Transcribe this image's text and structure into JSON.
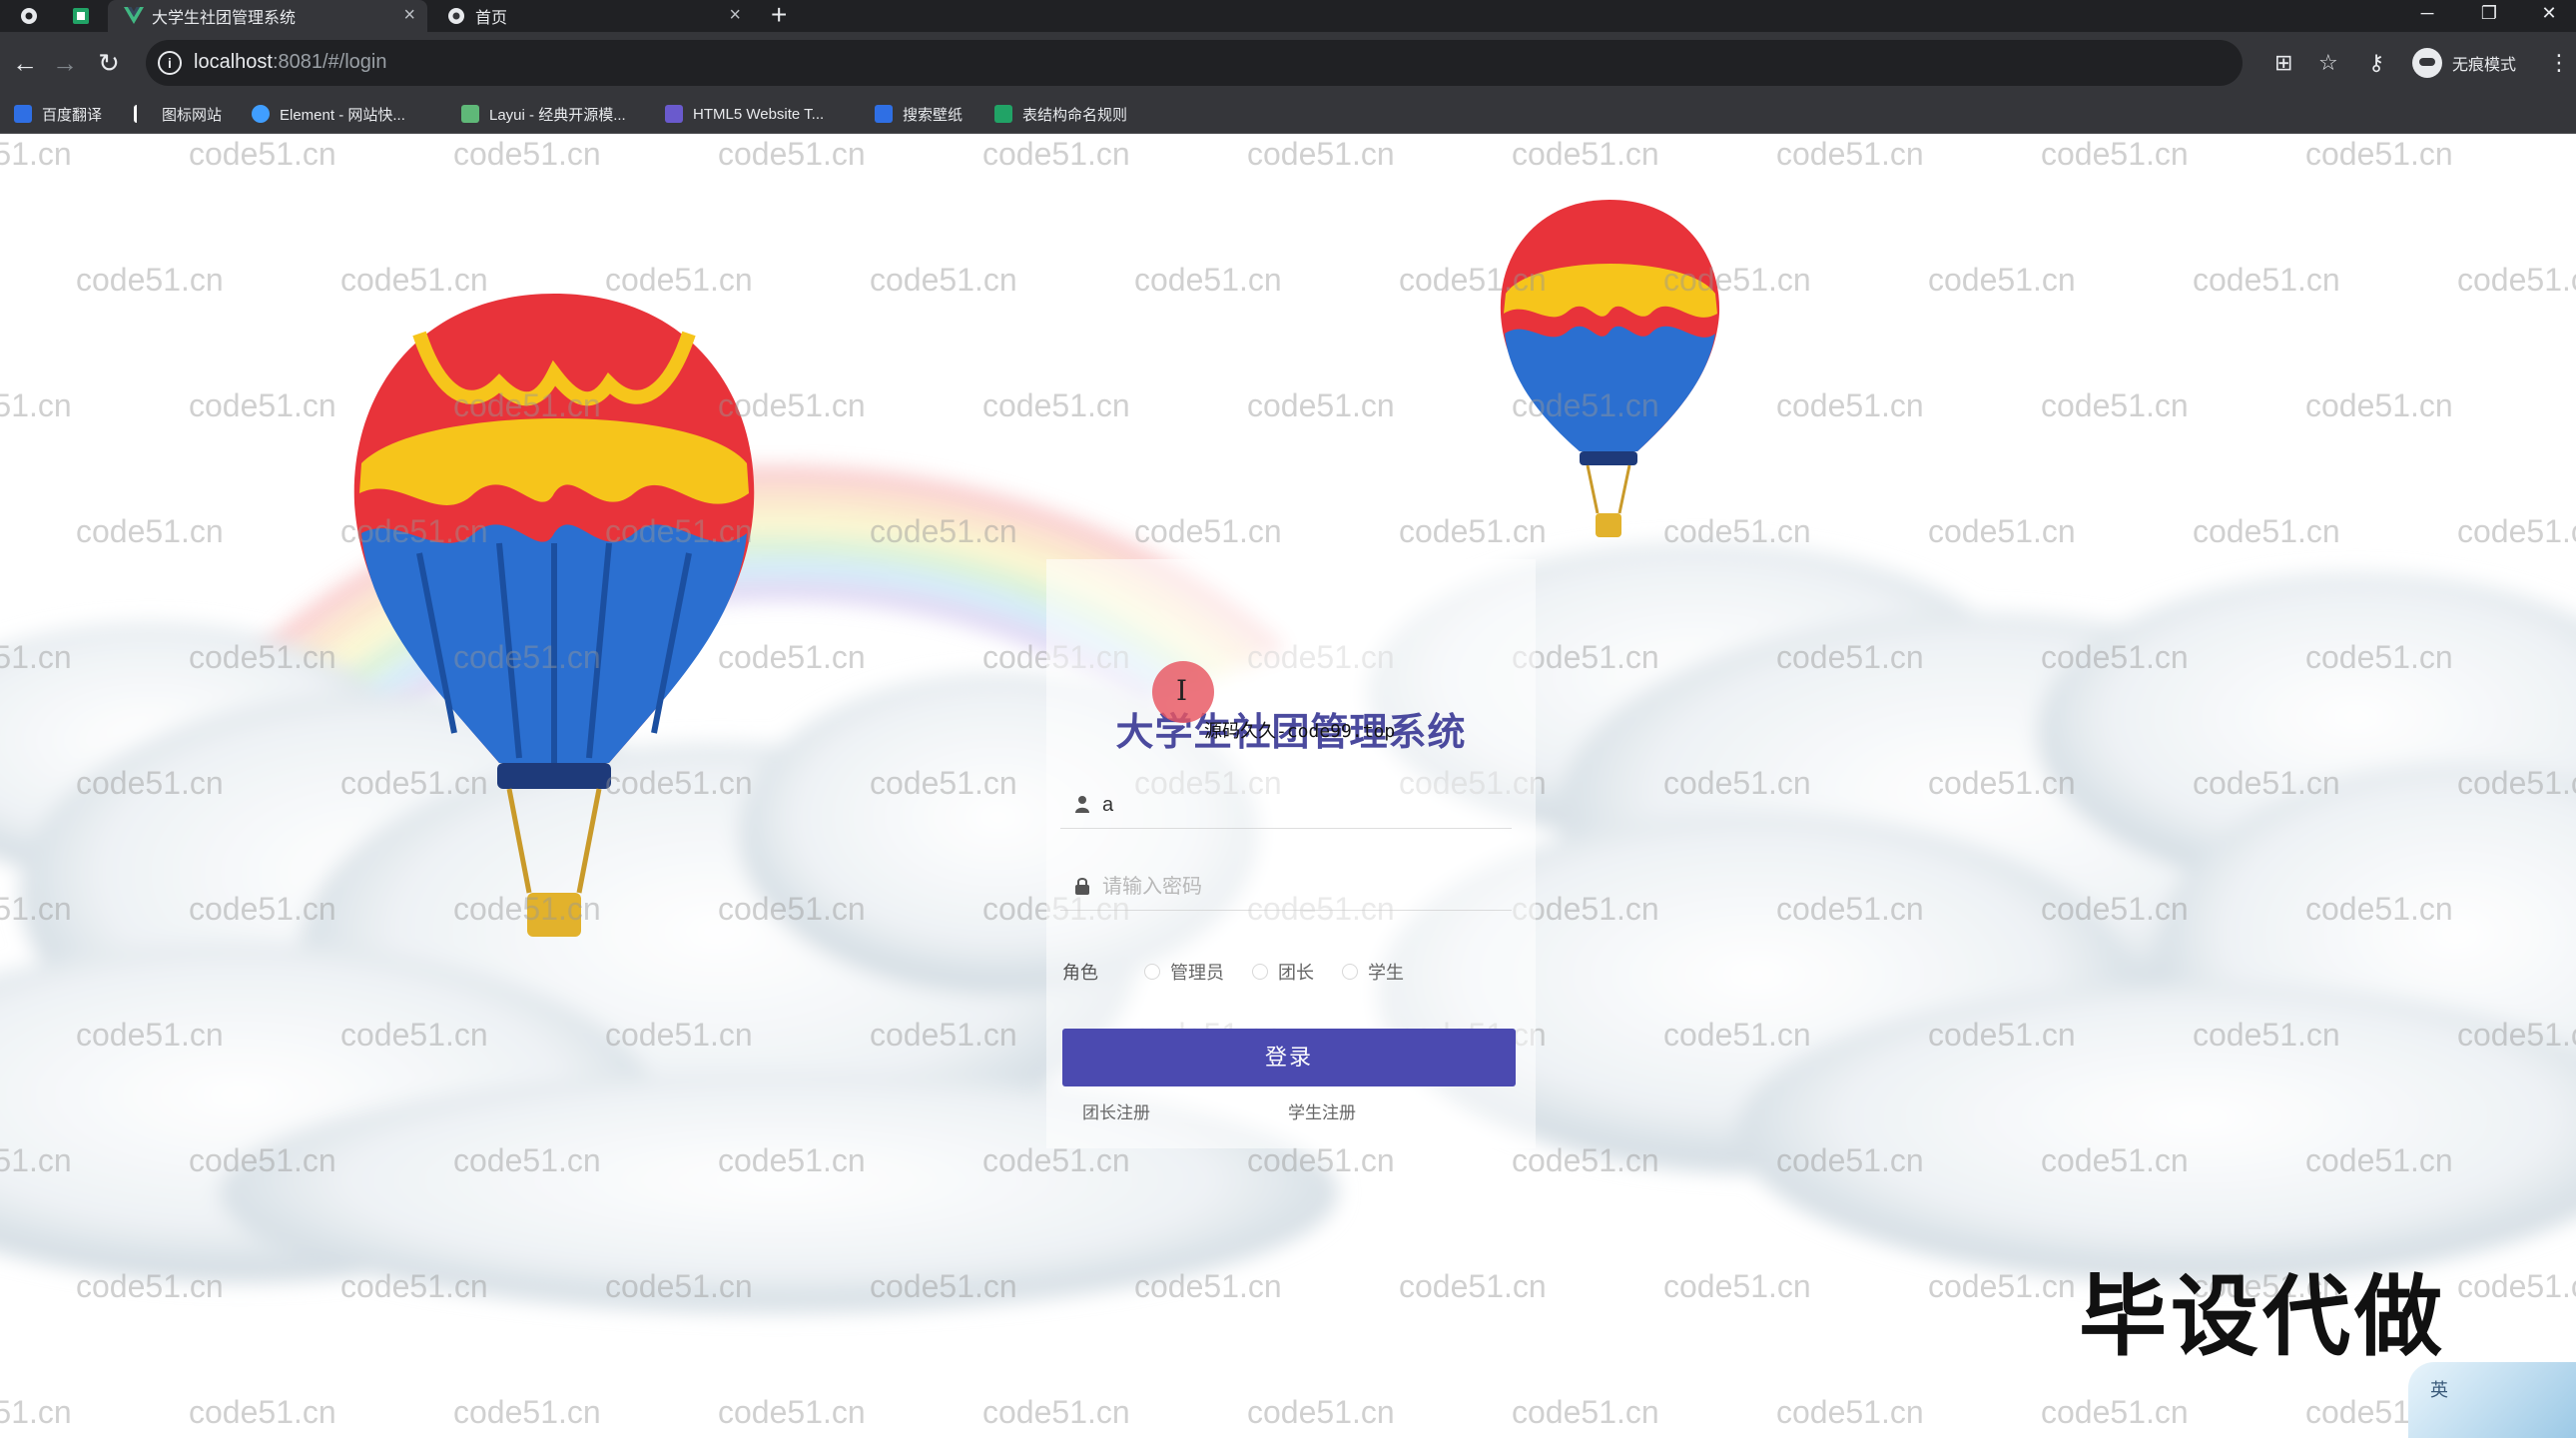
{
  "browser": {
    "tabs": [
      {
        "title": "大学生社团管理系统",
        "favicon": "vue-icon",
        "active": true
      },
      {
        "title": "首页",
        "favicon": "globe-icon",
        "active": false
      }
    ],
    "window_controls": {
      "minimize": "─",
      "restore": "❐",
      "close": "✕"
    },
    "new_tab": "+",
    "address": {
      "host": "localhost",
      "rest": ":8081/#/login"
    },
    "profile_label": "无痕模式",
    "bookmarks": [
      {
        "label": "百度翻译",
        "color": "#2f6fe4"
      },
      {
        "label": "图标网站",
        "color": "#ffffff"
      },
      {
        "label": "Element - 网站快...",
        "color": "#409eff"
      },
      {
        "label": "Layui - 经典开源模...",
        "color": "#5fb878"
      },
      {
        "label": "HTML5 Website T...",
        "color": "#6a5acd"
      },
      {
        "label": "搜索壁纸",
        "color": "#2f6fe4"
      },
      {
        "label": "表结构命名规则",
        "color": "#21a366"
      }
    ]
  },
  "login": {
    "title": "大学生社团管理系统",
    "username_value": "a",
    "password_placeholder": "请输入密码",
    "role_label": "角色",
    "roles": [
      "管理员",
      "团长",
      "学生"
    ],
    "submit_label": "登录",
    "links": [
      "团长注册",
      "学生注册"
    ]
  },
  "overlay": {
    "watermark_text": "code51.cn",
    "source_caption": "源码久久-code99.top",
    "promo_text": "毕设代做",
    "ime_text": "英"
  },
  "colors": {
    "accent": "#4b4ab0",
    "title": "#4b4a9e",
    "chrome_dark": "#202124",
    "chrome": "#35363a"
  }
}
